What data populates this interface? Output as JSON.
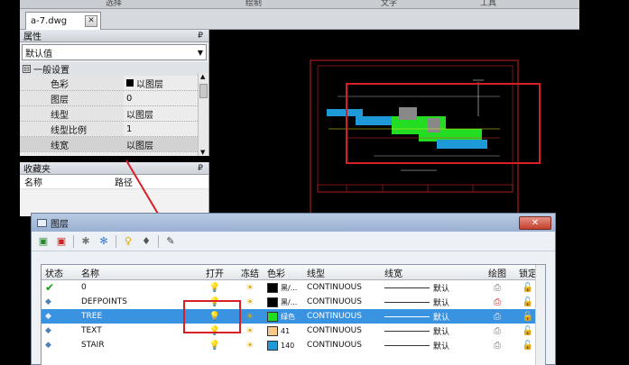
{
  "menu": {
    "items": [
      "选择",
      "绘制",
      "文字",
      "工具"
    ]
  },
  "tab": {
    "label": "a-7.dwg",
    "close": "✕"
  },
  "properties": {
    "title": "属性",
    "pin": "₽",
    "dropdown_value": "默认值",
    "group": "一般设置",
    "group_toggle": "⊟",
    "rows": [
      {
        "key": "色彩",
        "value": "以图层"
      },
      {
        "key": "图层",
        "value": "0"
      },
      {
        "key": "线型",
        "value": "以图层"
      },
      {
        "key": "线型比例",
        "value": "1"
      },
      {
        "key": "线宽",
        "value": "以图层"
      }
    ]
  },
  "favorites": {
    "title": "收藏夹",
    "pin": "₽",
    "col_name": "名称",
    "col_path": "路径"
  },
  "layer_dialog": {
    "title": "图层",
    "close": "✕",
    "headers": {
      "state": "状态",
      "name": "名称",
      "open": "打开",
      "freeze": "冻结",
      "color": "色彩",
      "ltype": "线型",
      "lweight": "线宽",
      "plot": "绘图",
      "lock": "锁定"
    },
    "rows": [
      {
        "name": "0",
        "color_name": "黑/...",
        "color_hex": "#000000",
        "ltype": "CONTINUOUS",
        "lweight": "默认",
        "current": true
      },
      {
        "name": "DEFPOINTS",
        "color_name": "黑/...",
        "color_hex": "#000000",
        "ltype": "CONTINUOUS",
        "lweight": "默认",
        "current": false
      },
      {
        "name": "TREE",
        "color_name": "绿色",
        "color_hex": "#22dd22",
        "ltype": "CONTINUOUS",
        "lweight": "默认",
        "current": false
      },
      {
        "name": "TEXT",
        "color_name": "41",
        "color_hex": "#f5c98a",
        "ltype": "CONTINUOUS",
        "lweight": "默认",
        "current": false
      },
      {
        "name": "STAIR",
        "color_name": "140",
        "color_hex": "#1e9ad8",
        "ltype": "CONTINUOUS",
        "lweight": "默认",
        "current": false
      }
    ],
    "selected_index": 2
  },
  "colors": {
    "accent_red": "#d81f26",
    "selection_blue": "#3a93e0"
  }
}
